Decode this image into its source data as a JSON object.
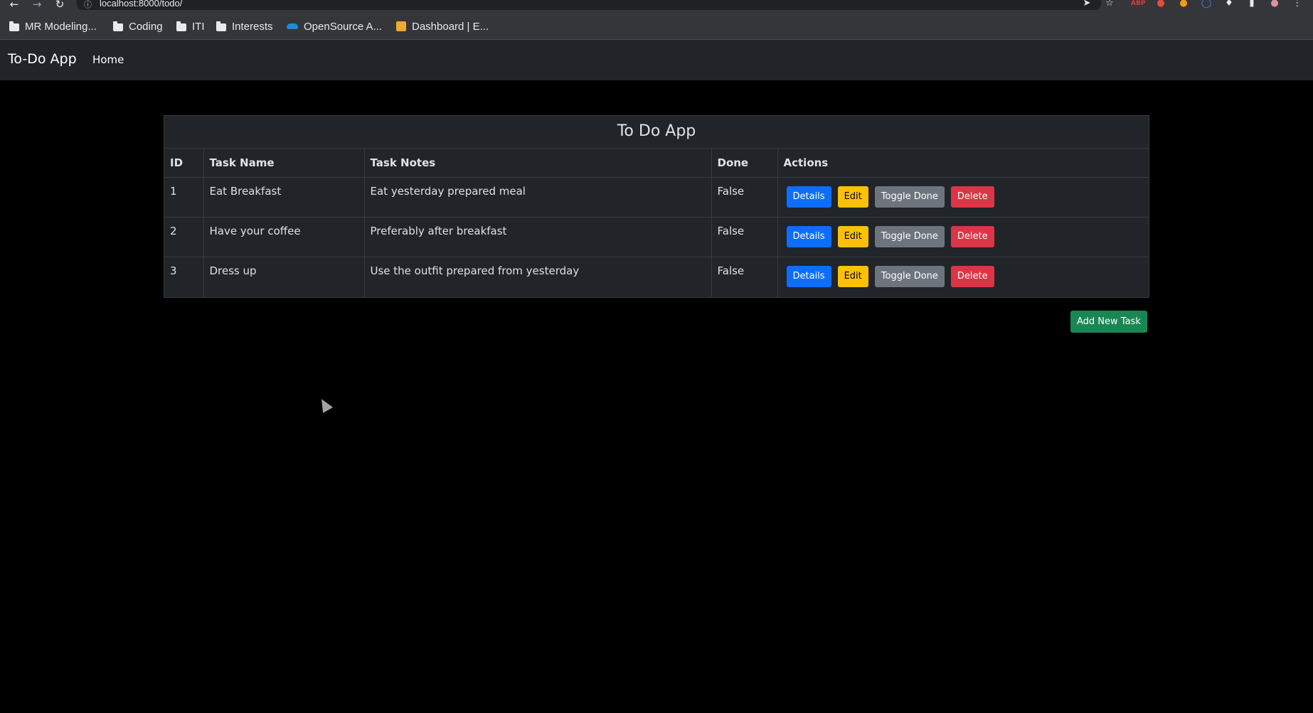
{
  "browser": {
    "url": "localhost:8000/todo/",
    "bookmarks": [
      {
        "label": "MR Modeling...",
        "icon": "folder-icon"
      },
      {
        "label": "Coding",
        "icon": "folder-icon"
      },
      {
        "label": "ITI",
        "icon": "folder-icon"
      },
      {
        "label": "Interests",
        "icon": "folder-icon"
      },
      {
        "label": "OpenSource A...",
        "icon": "cloud-icon"
      },
      {
        "label": "Dashboard | E...",
        "icon": "package-icon"
      }
    ]
  },
  "navbar": {
    "brand": "To-Do App",
    "home": "Home"
  },
  "table": {
    "caption": "To Do App",
    "headers": [
      "ID",
      "Task Name",
      "Task Notes",
      "Done",
      "Actions"
    ],
    "rows": [
      {
        "id": "1",
        "name": "Eat Breakfast",
        "notes": "Eat yesterday prepared meal",
        "done": "False"
      },
      {
        "id": "2",
        "name": "Have your coffee",
        "notes": "Preferably after breakfast",
        "done": "False"
      },
      {
        "id": "3",
        "name": "Dress up",
        "notes": "Use the outfit prepared from yesterday",
        "done": "False"
      }
    ],
    "actions": {
      "details": "Details",
      "edit": "Edit",
      "toggle": "Toggle Done",
      "delete": "Delete"
    }
  },
  "add_button": "Add New Task",
  "colors": {
    "primary": "#0d6efd",
    "warning": "#ffc107",
    "secondary": "#6c757d",
    "danger": "#dc3545",
    "success": "#198754",
    "navbar": "#212529"
  }
}
